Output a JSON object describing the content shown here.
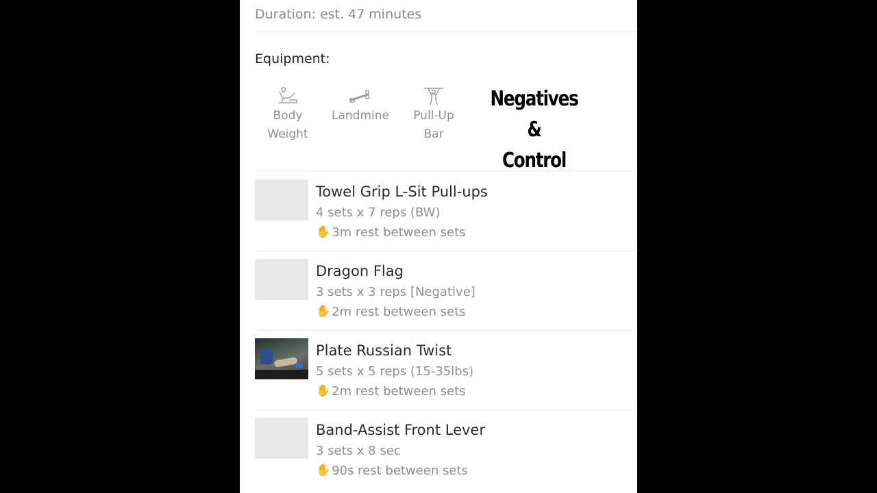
{
  "workout": {
    "duration": "Duration: est. 47 minutes",
    "equipment_title": "Equipment:",
    "equipment": [
      {
        "label": "Body\nWeight",
        "icon": "body-weight-icon"
      },
      {
        "label": "Landmine",
        "icon": "landmine-icon"
      },
      {
        "label": "Pull-Up\nBar",
        "icon": "pull-up-bar-icon"
      }
    ],
    "overlay_caption": "Negatives &\nControl"
  },
  "exercises": [
    {
      "name": "Towel Grip L-Sit Pull-ups",
      "sets": "4 sets x 7 reps (BW)",
      "rest": "3m rest between sets",
      "rest_icon": "waving-hand-icon"
    },
    {
      "name": "Dragon Flag",
      "sets": "3 sets x 3 reps [Negative]",
      "rest": "2m rest between sets",
      "rest_icon": "waving-hand-icon"
    },
    {
      "name": "Plate Russian Twist",
      "sets": "5 sets x 5 reps (15-35lbs)",
      "rest": "2m rest between sets",
      "rest_icon": "waving-hand-icon"
    },
    {
      "name": "Band-Assist Front Lever",
      "sets": "3 sets x 8 sec",
      "rest": "90s rest between sets",
      "rest_icon": "waving-hand-icon"
    }
  ],
  "colors": {
    "background": "#000000",
    "card": "#ffffff",
    "muted_text": "#8e8e8e",
    "thumb_placeholder": "#e8e8e8"
  }
}
